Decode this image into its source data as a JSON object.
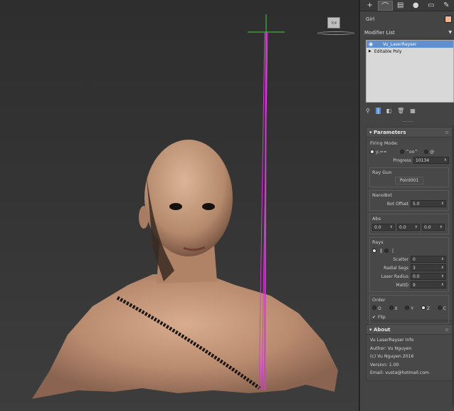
{
  "object": {
    "name": "Girl",
    "color": "#f3b98e"
  },
  "modifier_list": {
    "label": "Modifier List"
  },
  "stack": [
    {
      "label": "Vu_LaserRayser",
      "selected": true
    },
    {
      "label": "Editable Poly",
      "selected": false
    }
  ],
  "viewcube": {
    "label": "TOP"
  },
  "parameters": {
    "title": "Parameters",
    "firing_mode_label": "Firing Mode:",
    "firing_options": [
      "y;==",
      "^oo^",
      "@"
    ],
    "progress_label": "Progress",
    "progress_value": "10134",
    "ray_gun_label": "Ray Gun",
    "ray_gun_button": "Point001",
    "nanobot_label": "NanoBot",
    "bot_offset_label": "Bot Offset",
    "bot_offset_value": "5.0",
    "abs_label": "Abs",
    "abs_values": [
      "0.0",
      "0.0",
      "0.0"
    ],
    "rays_label": "Rays",
    "scatter_label": "Scatter",
    "scatter_value": "0",
    "radial_segs_label": "Radial Segs",
    "radial_segs_value": "3",
    "laser_radius_label": "Laser Radius",
    "laser_radius_value": "0.0",
    "matid_label": "MatID",
    "matid_value": "9",
    "order_label": "Order",
    "order_options": [
      "O",
      "X",
      "Y",
      "Z",
      "C"
    ],
    "flip_label": "Flip"
  },
  "about": {
    "title": "About",
    "lines": [
      "Vu LaserRayser Info",
      "Author: Vu Nguyen",
      "(c) Vu Nguyen 2016",
      "Version: 1.00",
      "Email: vusta@hotmail.com"
    ]
  },
  "colors": {
    "laser": "#d63ad6",
    "gizmo": "#3fd23f",
    "selection": "#5f8fcf"
  }
}
